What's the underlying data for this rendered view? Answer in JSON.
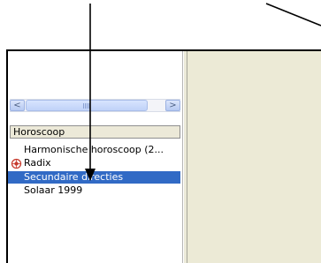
{
  "colors": {
    "selection": "#316ac5",
    "panel_bg": "#ecead6",
    "icon_red": "#c73b2f"
  },
  "scrollbar": {
    "left_arrow": "<",
    "right_arrow": ">"
  },
  "panel": {
    "header": "Horoscoop",
    "items": [
      {
        "label": "Harmonische horoscoop (2...",
        "icon": "none"
      },
      {
        "label": "Radix",
        "icon": "radix-icon"
      },
      {
        "label": "Secundaire directies",
        "icon": "none",
        "selected": true
      },
      {
        "label": "Solaar 1999",
        "icon": "none"
      }
    ]
  }
}
